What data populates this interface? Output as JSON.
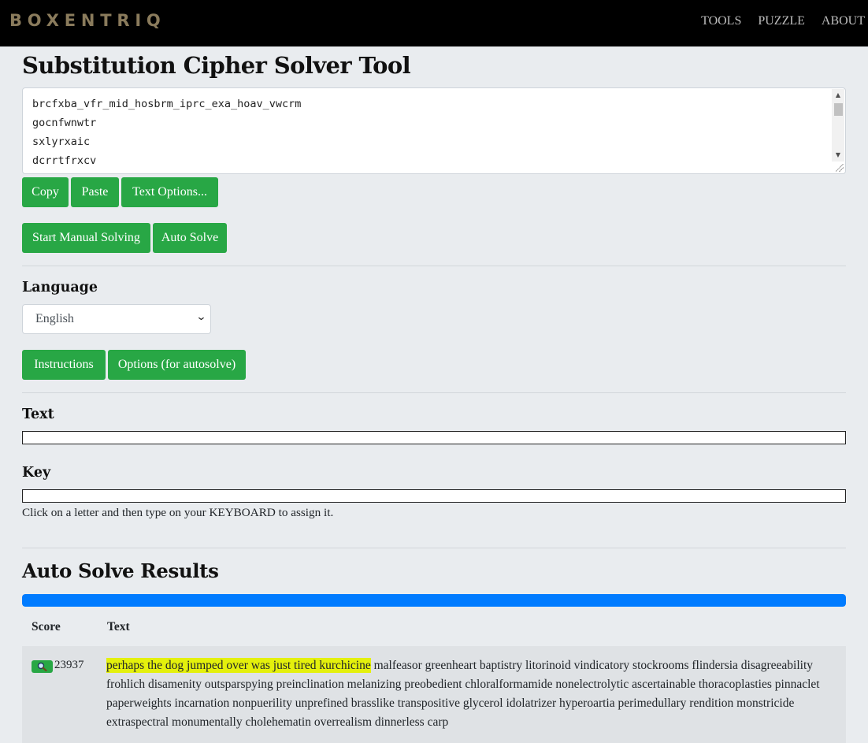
{
  "nav": {
    "brand": "BOXENTRIQ",
    "links": [
      "TOOLS",
      "PUZZLE",
      "ABOUT"
    ]
  },
  "page": {
    "title": "Substitution Cipher Solver Tool"
  },
  "cipher_input": {
    "lines": [
      "brcfxba_vfr_mid_hosbrm_iprc_exa_hoav_vwcrm",
      "gocnfwnwtr",
      "sxlyrxaic",
      "dcrrtfrxcv"
    ]
  },
  "buttons": {
    "copy": "Copy",
    "paste": "Paste",
    "text_options": "Text Options...",
    "start_manual": "Start Manual Solving",
    "auto_solve": "Auto Solve",
    "instructions": "Instructions",
    "options_autosolve": "Options (for autosolve)"
  },
  "language": {
    "label": "Language",
    "selected": "English"
  },
  "text_section": {
    "label": "Text"
  },
  "key_section": {
    "label": "Key",
    "helper": "Click on a letter and then type on your KEYBOARD to assign it."
  },
  "results": {
    "title": "Auto Solve Results",
    "progress": 1.0,
    "headers": {
      "score": "Score",
      "text": "Text"
    },
    "row": {
      "score": "23937",
      "highlighted": "perhaps the dog jumped over was just tired kurchicine",
      "rest": "malfeasor greenheart baptistry litorinoid vindicatory stockrooms flindersia disagreeability frohlich disamenity outsparspying preinclination melanizing preobedient chloralformamide nonelectrolytic ascertainable thoracoplasties pinnaclet paperweights incarnation nonpuerility unprefined brasslike transpositive glycerol idolatrizer hyperoartia perimedullary rendition monstricide extraspectral monumentally cholehematin overrealism dinnerless carp"
    }
  },
  "colors": {
    "navbar": "#000000",
    "brand": "#8a7b5c",
    "button": "#28a745",
    "progress": "#007bff",
    "highlight": "#e4f00c",
    "background": "#e9ecef"
  },
  "icons": {
    "search_badge": "magnifier-icon",
    "select_arrow": "chevron-down-icon"
  }
}
